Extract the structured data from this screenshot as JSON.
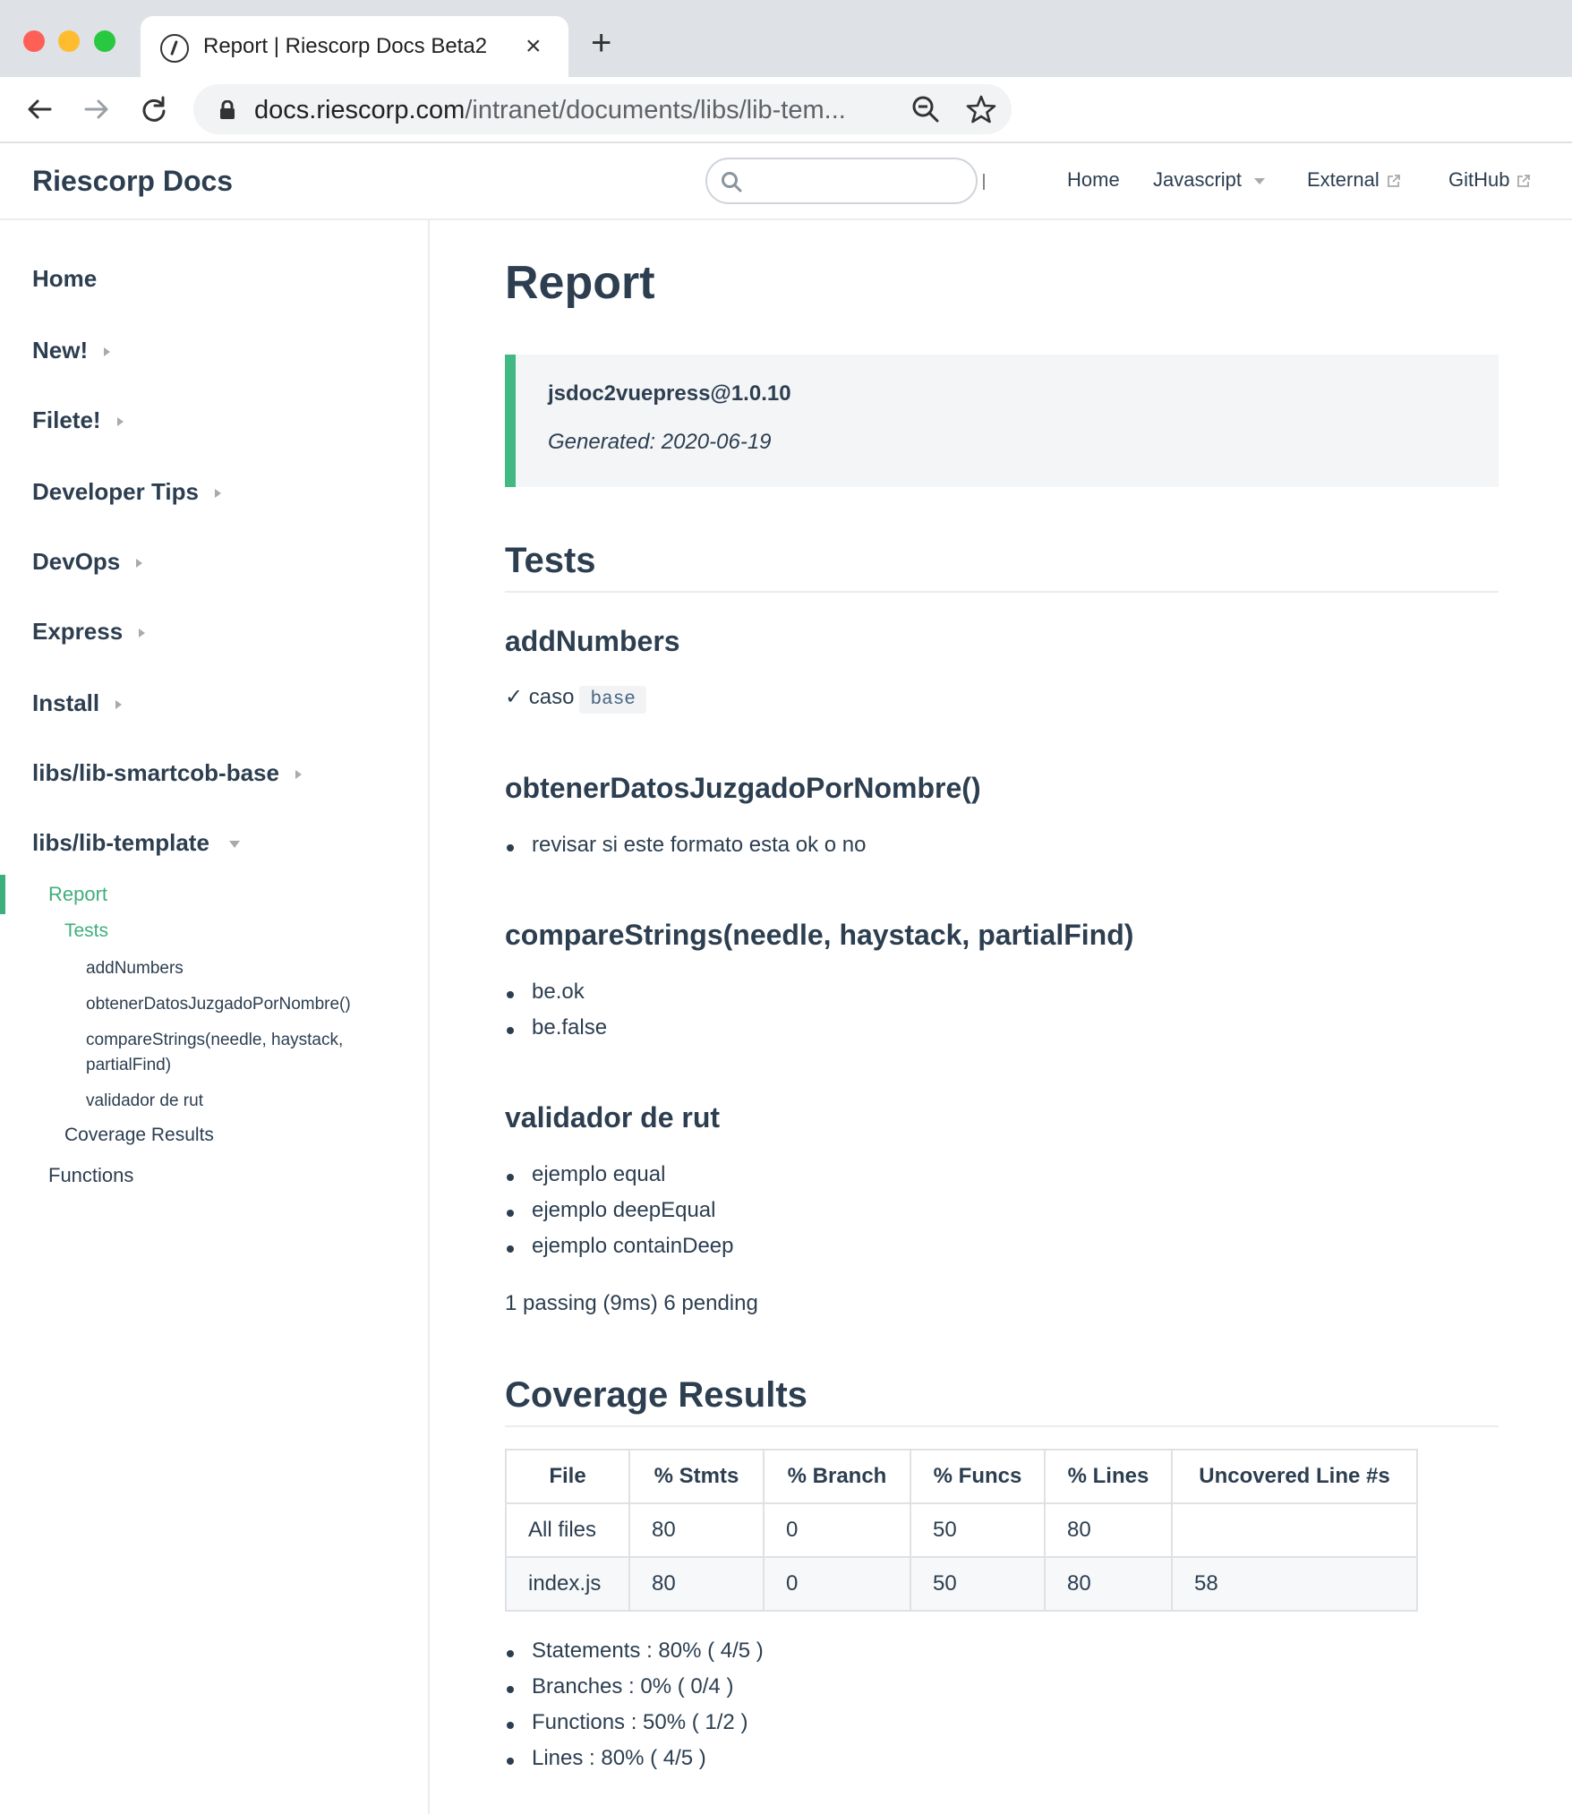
{
  "browser": {
    "tab_title": "Report | Riescorp Docs Beta2",
    "url_host": "docs.riescorp.com",
    "url_path": "/intranet/documents/libs/lib-tem..."
  },
  "navbar": {
    "site_name": "Riescorp Docs",
    "search_placeholder": "",
    "links": [
      "Home",
      "Javascript",
      "External",
      "GitHub"
    ]
  },
  "sidebar": {
    "groups": [
      "Home",
      "New!",
      "Filete!",
      "Developer Tips",
      "DevOps",
      "Express",
      "Install",
      "libs/lib-smartcob-base",
      "libs/lib-template"
    ],
    "sub": {
      "report": "Report",
      "tests": "Tests",
      "add_numbers": "addNumbers",
      "obtener": "obtenerDatosJuzgadoPorNombre()",
      "compare_line1": "compareStrings(needle, haystack,",
      "compare_line2": "partialFind)",
      "validador": "validador de rut",
      "coverage": "Coverage Results",
      "functions": "Functions"
    }
  },
  "main": {
    "title": "Report",
    "tip": {
      "title": "jsdoc2vuepress@1.0.10",
      "generated": "Generated: 2020-06-19"
    },
    "tests_heading": "Tests",
    "add_numbers": {
      "heading": "addNumbers",
      "check": "✓ caso",
      "code": "base"
    },
    "obtener": {
      "heading": "obtenerDatosJuzgadoPorNombre()",
      "items": [
        "revisar si este formato esta ok o no"
      ]
    },
    "compare": {
      "heading": "compareStrings(needle, haystack, partialFind)",
      "items": [
        "be.ok",
        "be.false"
      ]
    },
    "validador": {
      "heading": "validador de rut",
      "items": [
        "ejemplo equal",
        "ejemplo deepEqual",
        "ejemplo containDeep"
      ]
    },
    "summary": "1 passing (9ms) 6 pending",
    "coverage_heading": "Coverage Results",
    "table": {
      "headers": [
        "File",
        "% Stmts",
        "% Branch",
        "% Funcs",
        "% Lines",
        "Uncovered Line #s"
      ],
      "rows": [
        [
          "All files",
          "80",
          "0",
          "50",
          "80",
          ""
        ],
        [
          "index.js",
          "80",
          "0",
          "50",
          "80",
          "58"
        ]
      ]
    },
    "coverage_items": [
      "Statements : 80% ( 4/5 )",
      "Branches : 0% ( 0/4 )",
      "Functions : 50% ( 1/2 )",
      "Lines : 80% ( 4/5 )"
    ]
  }
}
